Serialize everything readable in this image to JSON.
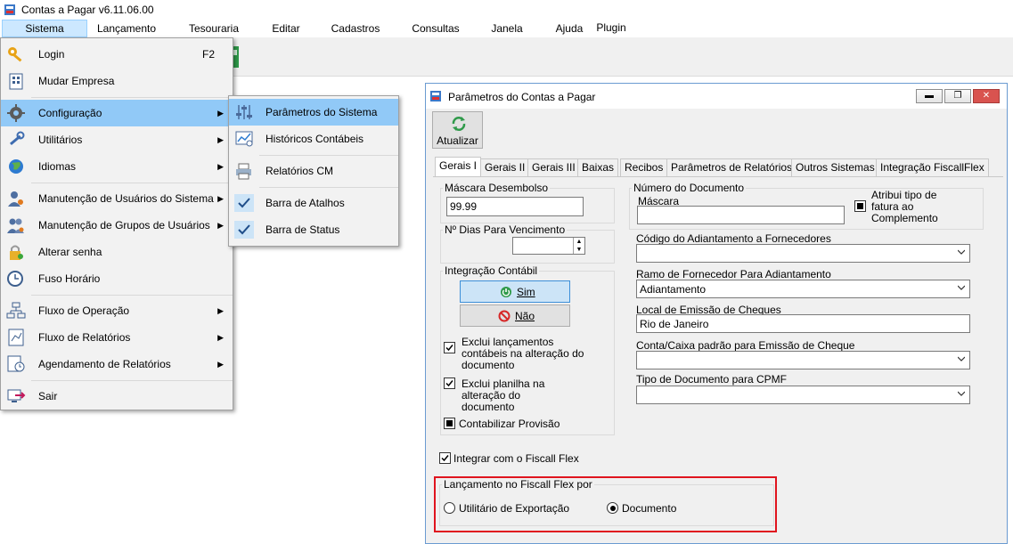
{
  "app": {
    "title": "Contas a Pagar v6.11.06.00"
  },
  "menubar": [
    {
      "label": "Sistema"
    },
    {
      "label": "Lançamento"
    },
    {
      "label": "Tesouraria"
    },
    {
      "label": "Editar"
    },
    {
      "label": "Cadastros"
    },
    {
      "label": "Consultas"
    },
    {
      "label": "Janela"
    },
    {
      "label": "Ajuda"
    },
    {
      "label": "Plugin"
    }
  ],
  "sistema_menu": {
    "items": [
      {
        "label": "Login",
        "shortcut": "F2",
        "icon": "key-icon"
      },
      {
        "label": "Mudar Empresa",
        "icon": "building-icon"
      },
      {
        "label": "Configuração",
        "icon": "gear-icon",
        "submenu": true
      },
      {
        "label": "Utilitários",
        "icon": "wrench-icon",
        "submenu": true
      },
      {
        "label": "Idiomas",
        "icon": "globe-icon",
        "submenu": true
      },
      {
        "label": "Manutenção de Usuários do Sistema",
        "icon": "user-icon",
        "submenu": true
      },
      {
        "label": "Manutenção de Grupos de Usuários",
        "icon": "users-icon",
        "submenu": true
      },
      {
        "label": "Alterar senha",
        "icon": "lock-icon"
      },
      {
        "label": "Fuso Horário",
        "icon": "clock-icon"
      },
      {
        "label": "Fluxo de Operação",
        "icon": "flowchart-icon",
        "submenu": true
      },
      {
        "label": "Fluxo de Relatórios",
        "icon": "report-flow-icon",
        "submenu": true
      },
      {
        "label": "Agendamento de Relatórios",
        "icon": "schedule-icon",
        "submenu": true
      },
      {
        "label": "Sair",
        "icon": "exit-icon"
      }
    ]
  },
  "config_submenu": {
    "items": [
      {
        "label": "Parâmetros do Sistema",
        "icon": "sliders-icon"
      },
      {
        "label": "Históricos Contábeis",
        "icon": "chart-icon"
      },
      {
        "label": "Relatórios CM",
        "icon": "printer-icon"
      },
      {
        "label": "Barra de Atalhos",
        "icon": "check-icon"
      },
      {
        "label": "Barra de Status",
        "icon": "check-icon"
      }
    ]
  },
  "dialog": {
    "title": "Parâmetros do Contas a Pagar",
    "refresh_label": "Atualizar",
    "tabs": [
      {
        "label": "Gerais I"
      },
      {
        "label": "Gerais II"
      },
      {
        "label": "Gerais III"
      },
      {
        "label": "Baixas"
      },
      {
        "label": "Recibos"
      },
      {
        "label": "Parâmetros de Relatórios"
      },
      {
        "label": "Outros Sistemas"
      },
      {
        "label": "Integração FiscallFlex"
      }
    ],
    "mascara_desembolso": {
      "label": "Máscara Desembolso",
      "value": "99.99"
    },
    "dias_vencimento": {
      "label": "Nº Dias Para Vencimento",
      "value": ""
    },
    "integracao_contabil": {
      "label": "Integração Contábil",
      "sim": "Sim",
      "nao": "Não",
      "exclui_lancamentos": {
        "line1": "Exclui lançamentos",
        "line2": "contábeis na alteração do",
        "line3": "documento",
        "checked": true
      },
      "exclui_planilha": {
        "line1": "Exclui planilha na",
        "line2": "alteração do",
        "line3": "documento",
        "checked": true
      },
      "contabilizar_provisao": {
        "label": "Contabilizar Provisão"
      }
    },
    "numero_documento": {
      "label": "Número do Documento",
      "mascara_label": "Máscara",
      "mascara_value": "",
      "atribui": {
        "line1": "Atribui tipo de",
        "line2": "fatura ao",
        "line3": "Complemento"
      }
    },
    "codigo_adiantamento": {
      "label": "Código do Adiantamento a Fornecedores",
      "value": ""
    },
    "ramo_fornecedor": {
      "label": "Ramo de Fornecedor Para Adiantamento",
      "value": "Adiantamento"
    },
    "local_emissao": {
      "label": "Local de Emissão de Cheques",
      "value": "Rio de Janeiro"
    },
    "conta_caixa": {
      "label": "Conta/Caixa padrão para Emissão de Cheque",
      "value": ""
    },
    "tipo_documento_cpmf": {
      "label": "Tipo de Documento para CPMF",
      "value": ""
    },
    "integrar_fiscall": {
      "label": "Integrar com o Fiscall Flex",
      "checked": true
    },
    "lancamento_fiscall": {
      "label": "Lançamento no Fiscall Flex por",
      "opt1": "Utilitário de Exportação",
      "opt2": "Documento",
      "selected": "Documento"
    }
  },
  "colors": {
    "highlight": "#91c9f7",
    "accent_red": "#e0141e",
    "title_blue": "#6b9bd1"
  }
}
